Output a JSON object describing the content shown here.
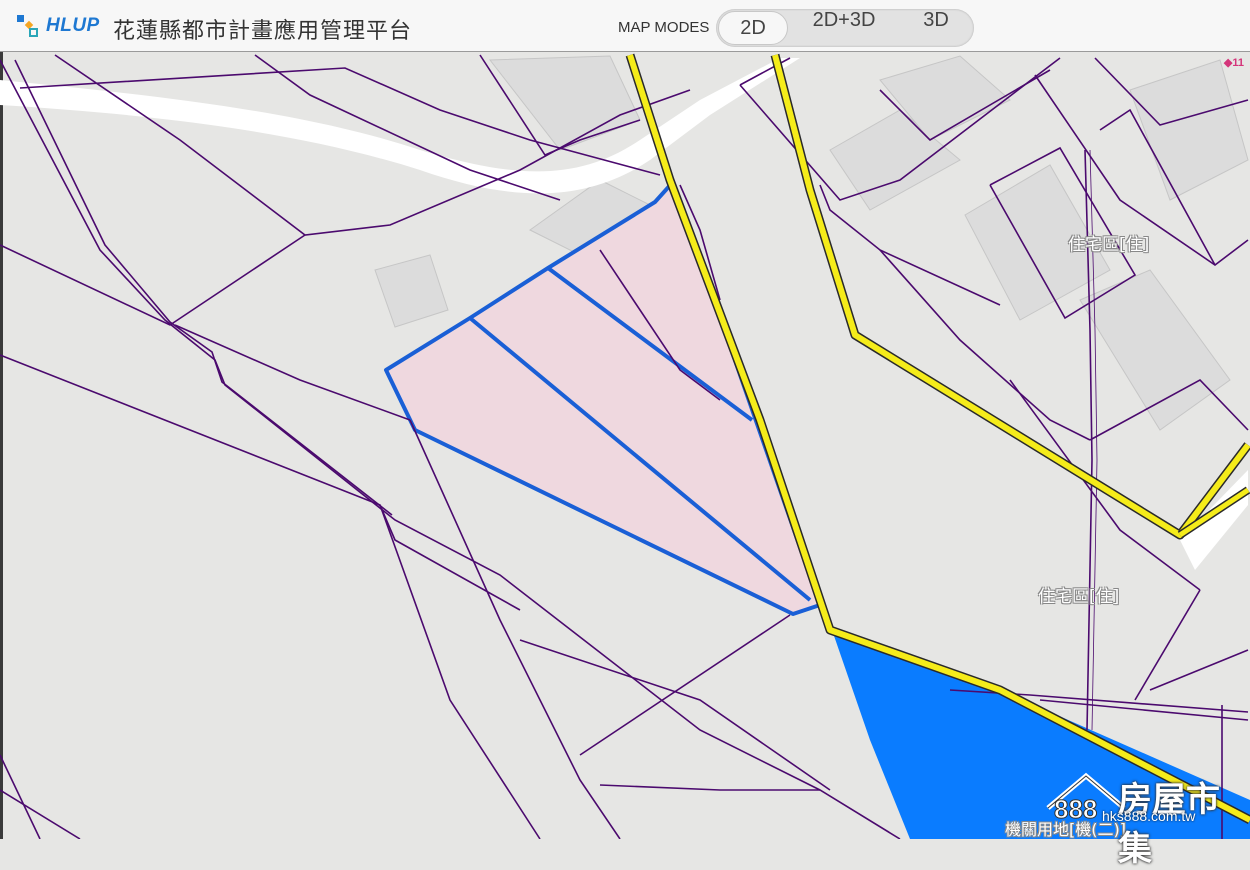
{
  "header": {
    "brand": "HLUP",
    "title": "花蓮縣都市計畫應用管理平台",
    "modes_label": "MAP MODES",
    "modes": [
      "2D",
      "2D+3D",
      "3D"
    ],
    "active_mode": "2D"
  },
  "map": {
    "counter": "11",
    "zone_labels": [
      "住宅區[住]",
      "住宅區[住]",
      "機關用地[機(二)]"
    ],
    "colors": {
      "parcel_line": "#4b0a6e",
      "selection_outline": "#1a5fd6",
      "selection_fill": "#f0d8e0",
      "zone_boundary": "#f5ec1a",
      "institution_zone": "#0a7cff",
      "road": "#ffffff",
      "background": "#e6e6e4"
    }
  },
  "watermark": {
    "number": "888",
    "text": "房屋市集",
    "url": "hks888.com.tw"
  }
}
